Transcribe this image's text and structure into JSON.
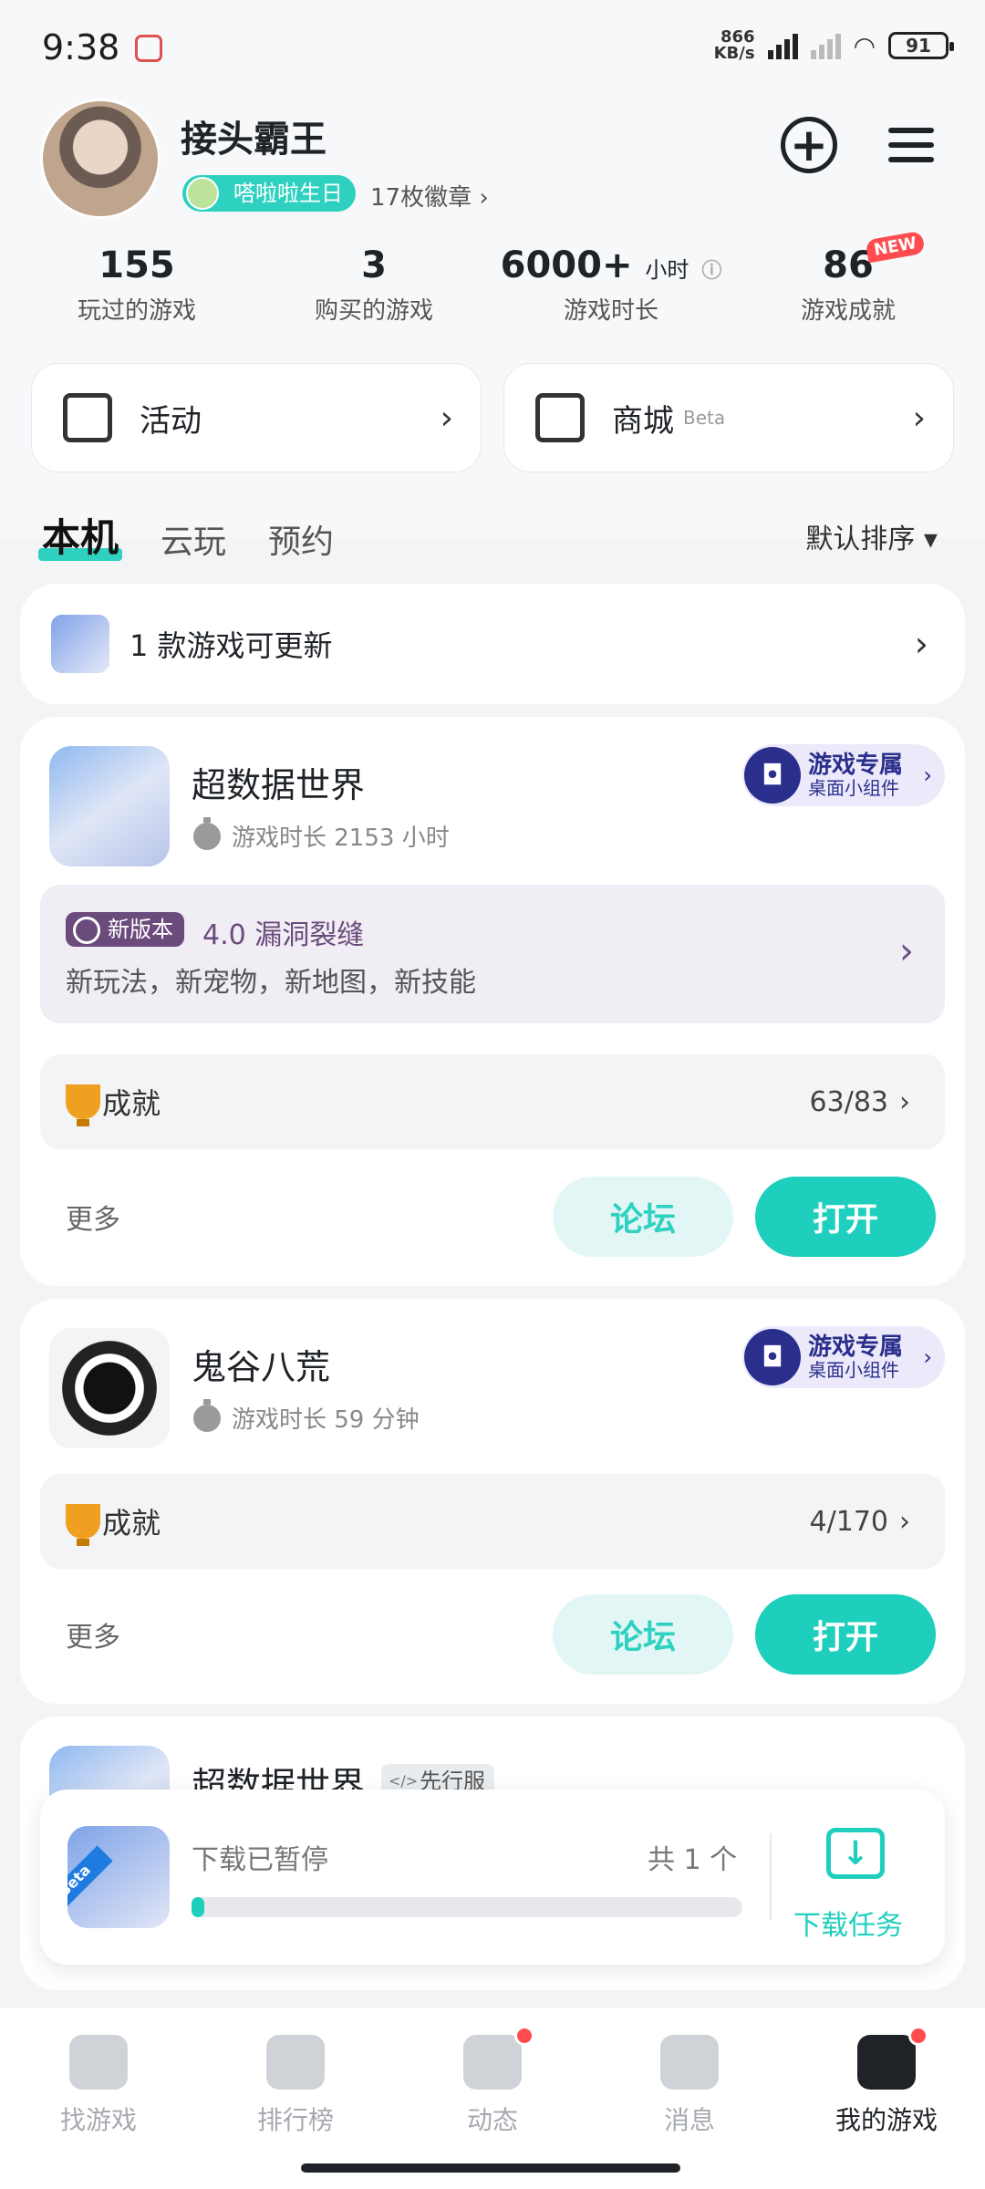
{
  "status_bar": {
    "time": "9:38",
    "net_speed": "866\nKB/s",
    "battery": "91"
  },
  "profile": {
    "username": "接头霸王",
    "birthday_badge": "嗒啦啦生日",
    "medals": "17枚徽章 ›"
  },
  "stats": [
    {
      "value": "155",
      "unit": "",
      "label": "玩过的游戏"
    },
    {
      "value": "3",
      "unit": "",
      "label": "购买的游戏"
    },
    {
      "value": "6000+",
      "unit": "小时",
      "label": "游戏时长"
    },
    {
      "value": "86",
      "unit": "",
      "label": "游戏成就",
      "tag": "NEW"
    }
  ],
  "shortcuts": {
    "activity": {
      "label": "活动",
      "chev": "›"
    },
    "mall": {
      "label": "商城",
      "beta": "Beta",
      "chev": "›"
    }
  },
  "tabs": [
    "本机",
    "云玩",
    "预约"
  ],
  "sort_label": "默认排序 ▾",
  "update_notice": "1 款游戏可更新",
  "widget_badge": {
    "title": "游戏专属",
    "subtitle": "桌面小组件"
  },
  "games": [
    {
      "title": "超数据世界",
      "playtime": "游戏时长 2153 小时",
      "new_version": {
        "tag": "新版本",
        "title": "4.0 漏洞裂缝",
        "desc": "新玩法，新宠物，新地图，新技能"
      },
      "achievement_label": "成就",
      "achievement_value": "63/83",
      "more": "更多",
      "forum": "论坛",
      "open": "打开"
    },
    {
      "title": "鬼谷八荒",
      "playtime": "游戏时长 59 分钟",
      "achievement_label": "成就",
      "achievement_value": "4/170",
      "more": "更多",
      "forum": "论坛",
      "open": "打开"
    },
    {
      "title": "超数据世界",
      "tag": "先行服"
    }
  ],
  "download": {
    "status": "下载已暂停",
    "count": "共 1 个",
    "progress": 0.02,
    "task_label": "下载任务",
    "icon_band": "Beta"
  },
  "bottom_nav": [
    {
      "label": "找游戏",
      "icon": "find-game-icon"
    },
    {
      "label": "排行榜",
      "icon": "ranking-icon"
    },
    {
      "label": "动态",
      "icon": "feed-icon"
    },
    {
      "label": "消息",
      "icon": "message-icon"
    },
    {
      "label": "我的游戏",
      "icon": "my-games-icon"
    }
  ],
  "colors": {
    "accent": "#1fcfbe",
    "purple": "#6b4a7c",
    "badge_red": "#ff4d4f"
  }
}
